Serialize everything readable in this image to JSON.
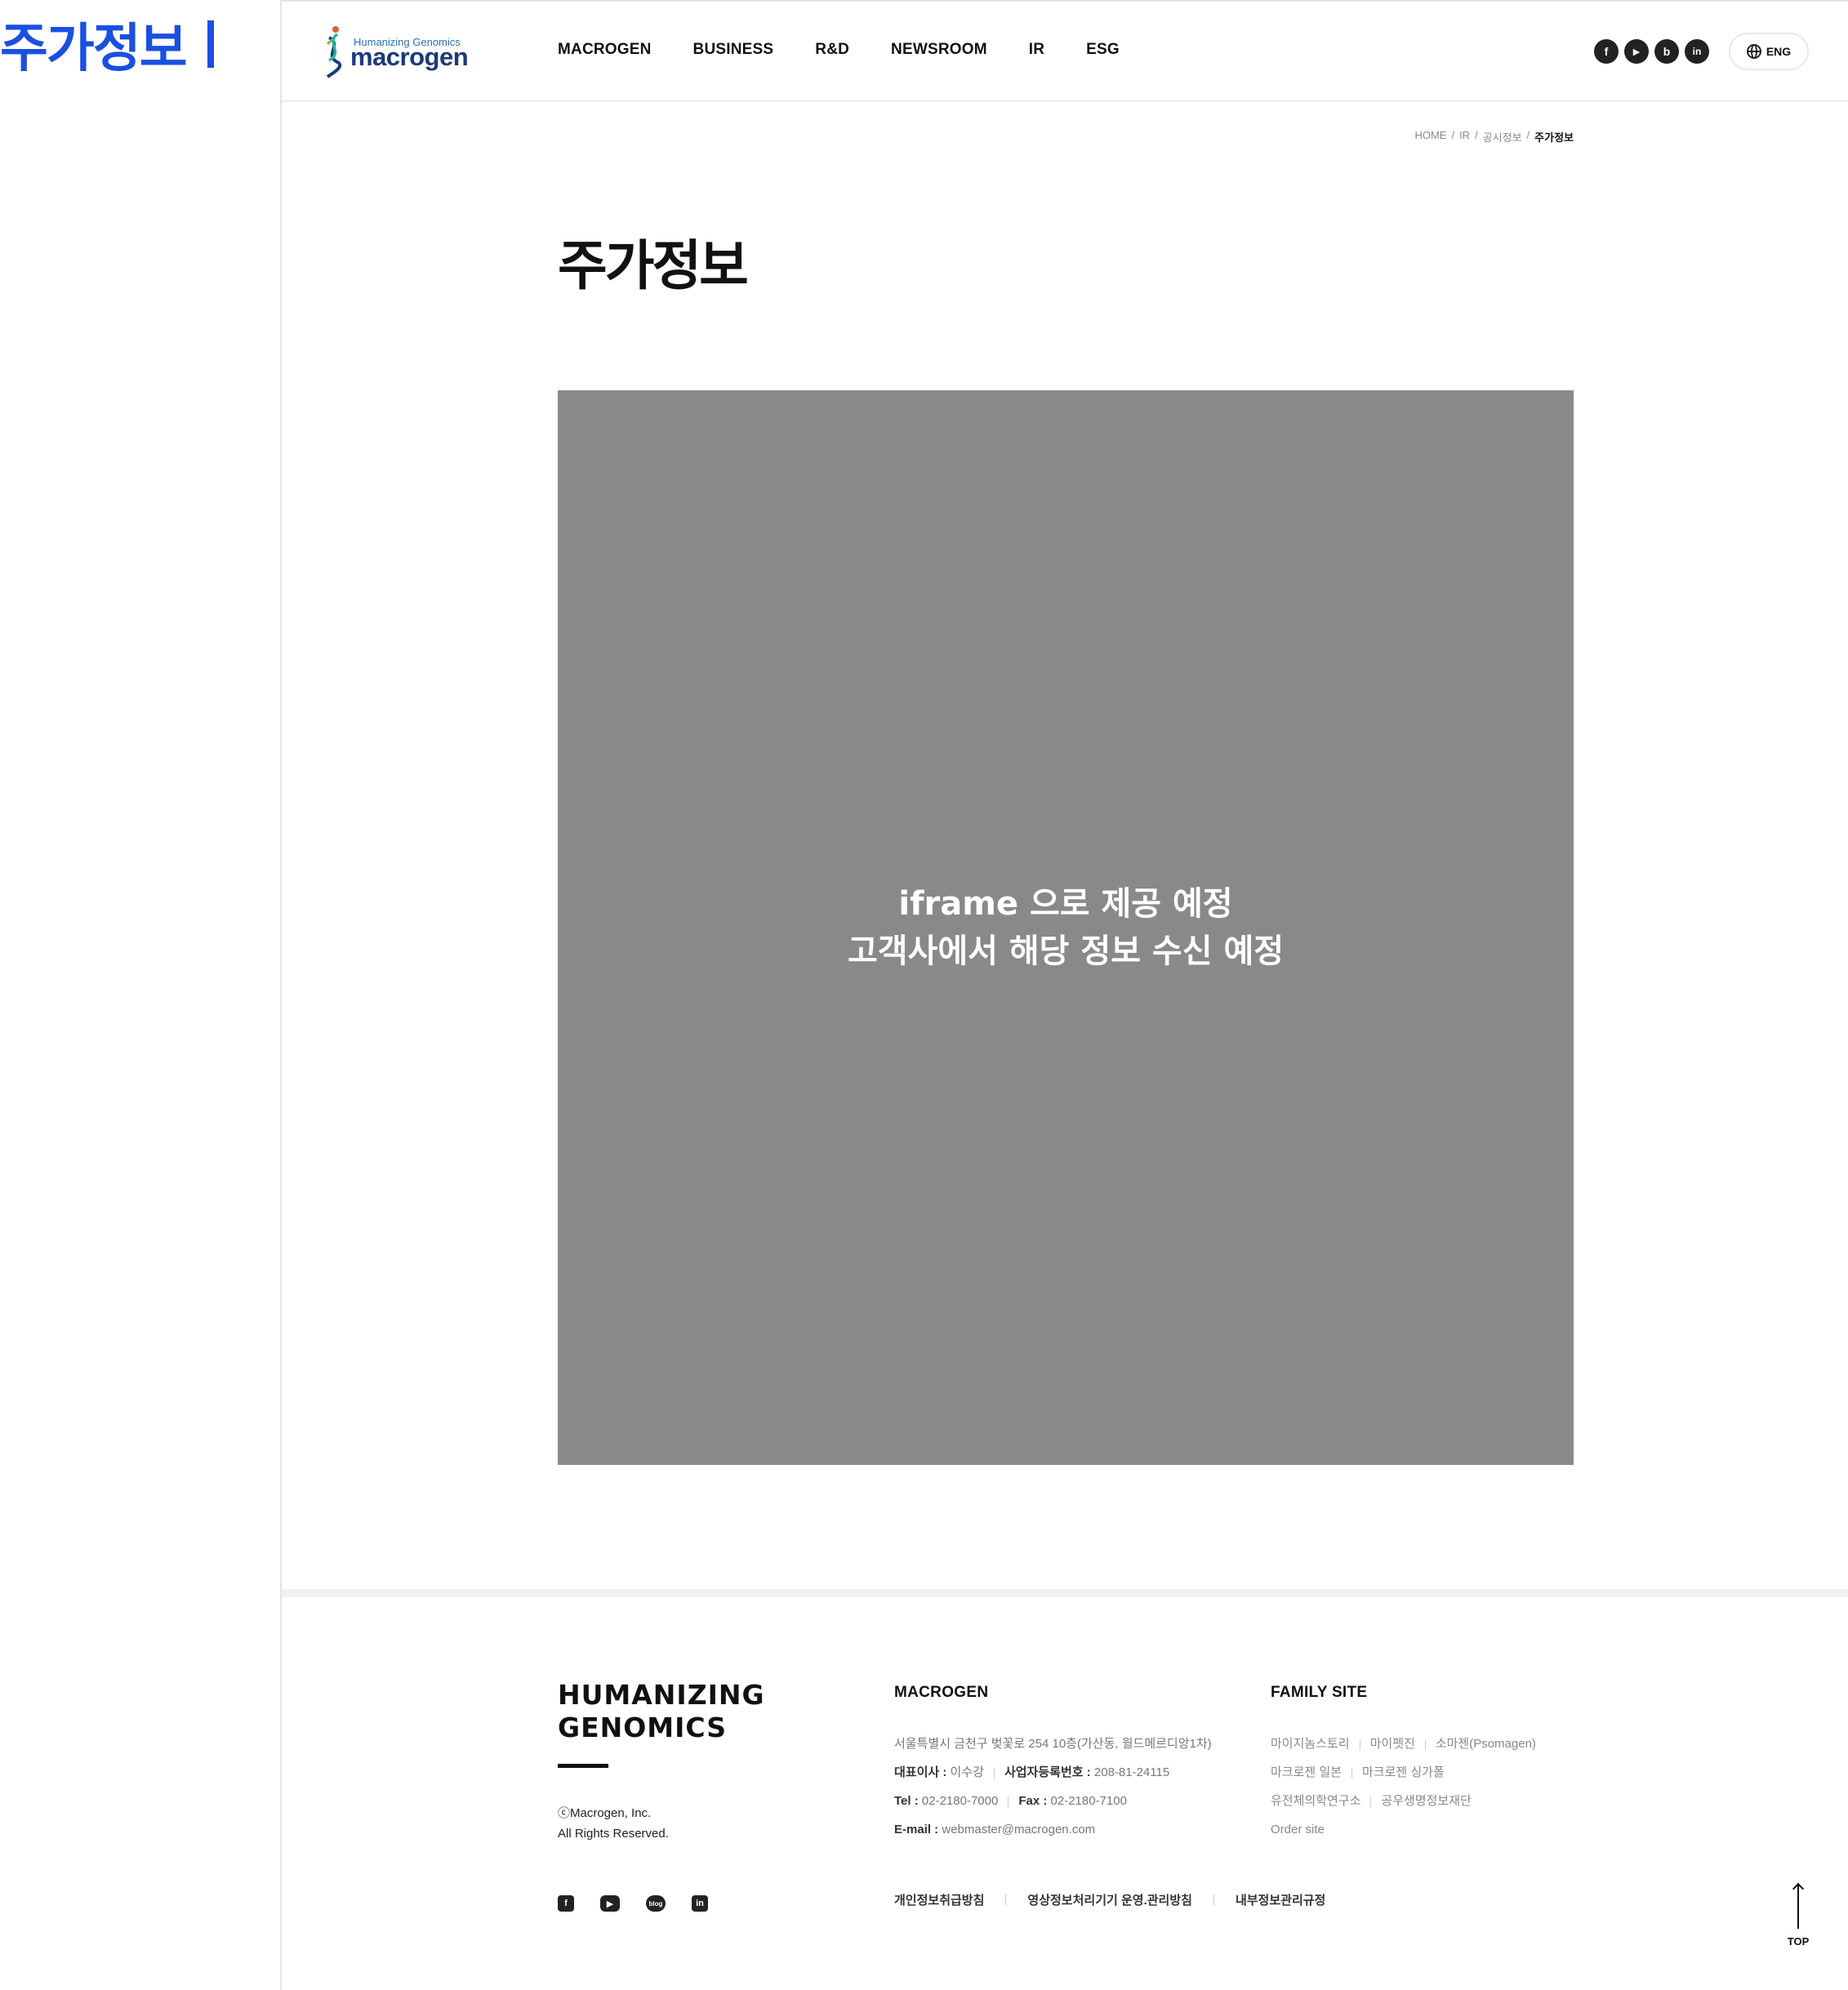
{
  "side_label": "주가정보",
  "header": {
    "logo_tagline": "Humanizing Genomics",
    "logo_word": "macrogen",
    "nav": [
      "MACROGEN",
      "BUSINESS",
      "R&D",
      "NEWSROOM",
      "IR",
      "ESG"
    ],
    "social": [
      {
        "icon": "facebook-icon",
        "glyph": "f"
      },
      {
        "icon": "youtube-icon",
        "glyph": "▶"
      },
      {
        "icon": "blog-icon",
        "glyph": "b"
      },
      {
        "icon": "linkedin-icon",
        "glyph": "in"
      }
    ],
    "lang_label": "ENG"
  },
  "breadcrumb": [
    "HOME",
    "IR",
    "공시정보",
    "주가정보"
  ],
  "page_title": "주가정보",
  "iframe_placeholder": {
    "line1": "iframe 으로 제공 예정",
    "line2": "고객사에서 해당 정보 수신 예정"
  },
  "footer": {
    "slogan_line1": "HUMANIZING",
    "slogan_line2": "GENOMICS",
    "copyright_line1": "ⓒMacrogen, Inc.",
    "copyright_line2": "All Rights Reserved.",
    "macrogen_heading": "MACROGEN",
    "address": "서울특별시 금천구 벚꽃로 254 10층(가산동, 월드메르디앙1차)",
    "ceo_label": "대표이사 :",
    "ceo_value": "이수강",
    "bizno_label": "사업자등록번호 :",
    "bizno_value": "208-81-24115",
    "tel_label": "Tel :",
    "tel_value": "02-2180-7000",
    "fax_label": "Fax :",
    "fax_value": "02-2180-7100",
    "email_label": "E-mail :",
    "email_value": "webmaster@macrogen.com",
    "family_heading": "FAMILY SITE",
    "family_row1": [
      "마이지놈스토리",
      "마이펫진",
      "소마젠(Psomagen)"
    ],
    "family_row2": [
      "마크로젠 일본",
      "마크로젠 싱가폴"
    ],
    "family_row3": [
      "유전체의학연구소",
      "공우생명정보재단"
    ],
    "family_row4": [
      "Order site"
    ],
    "policies": [
      "개인정보취급방침",
      "영상정보처리기기 운영.관리방침",
      "내부정보관리규정"
    ],
    "top_label": "TOP"
  }
}
